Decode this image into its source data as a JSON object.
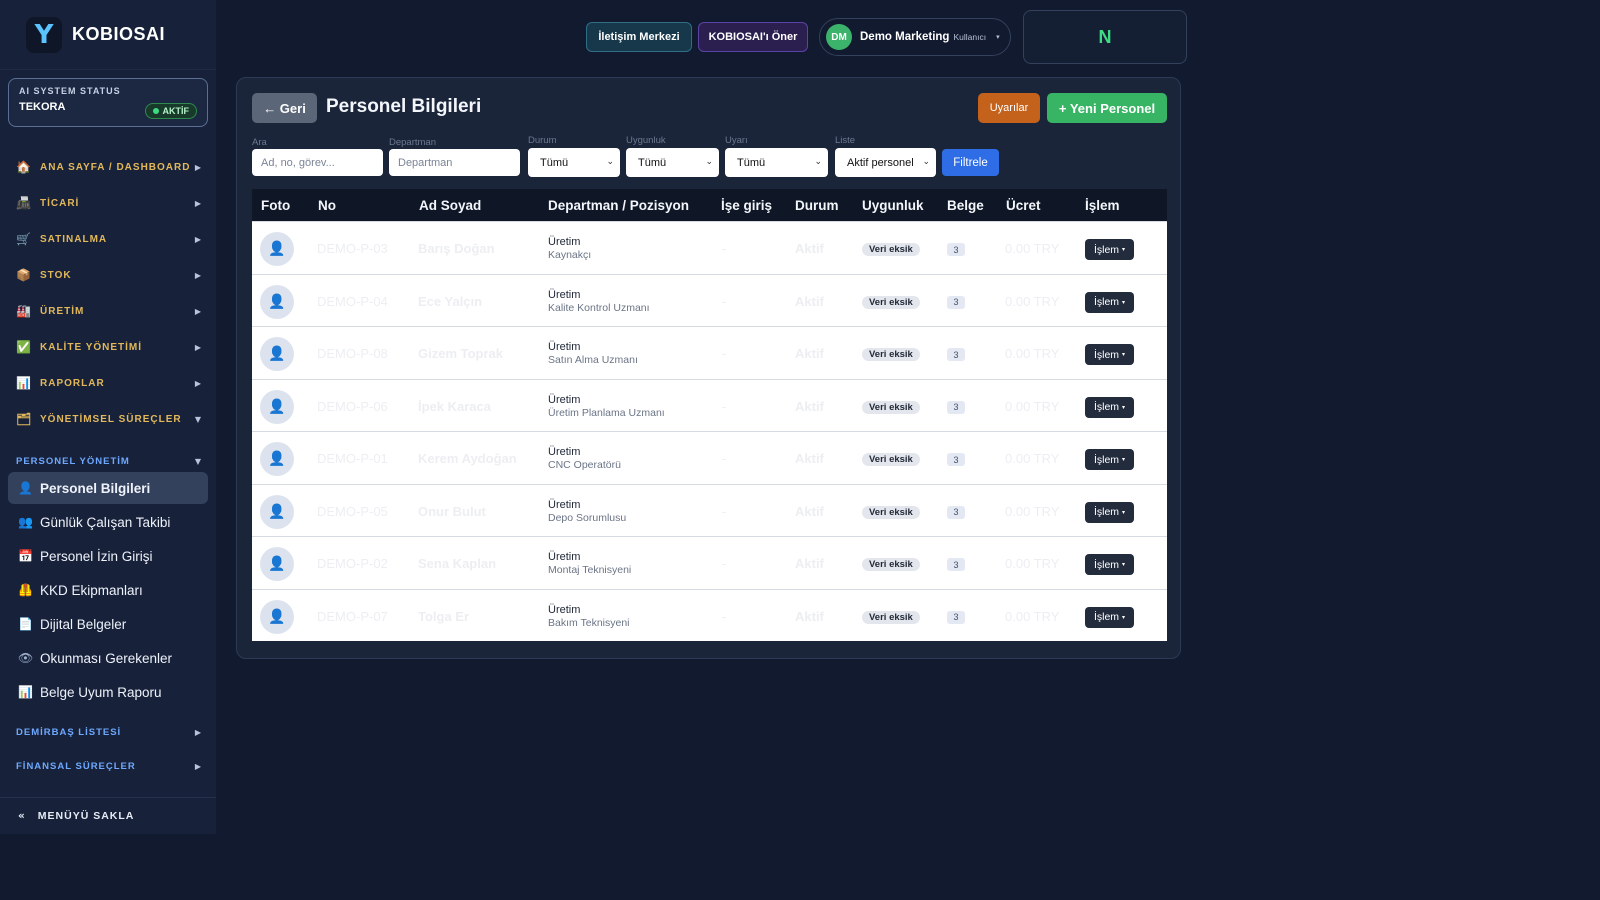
{
  "app": {
    "logo_letter": "Y",
    "name": "KOBIOSAI"
  },
  "system_status": {
    "label": "AI SYSTEM STATUS",
    "name": "TEKORA",
    "badge": "AKTİF"
  },
  "nav": [
    {
      "icon": "home-icon",
      "glyph": "🏠",
      "label": "ANA SAYFA / DASHBOARD",
      "arrow": "▶"
    },
    {
      "icon": "cart-icon",
      "glyph": "📠",
      "label": "TİCARİ",
      "arrow": "▶"
    },
    {
      "icon": "shopping-icon",
      "glyph": "🛒",
      "label": "SATINALMA",
      "arrow": "▶"
    },
    {
      "icon": "box-icon",
      "glyph": "📦",
      "label": "STOK",
      "arrow": "▶"
    },
    {
      "icon": "factory-icon",
      "glyph": "🏭",
      "label": "ÜRETİM",
      "arrow": "▶"
    },
    {
      "icon": "check-icon",
      "glyph": "✅",
      "label": "KALİTE YÖNETİMİ",
      "arrow": "▶"
    },
    {
      "icon": "chart-icon",
      "glyph": "📊",
      "label": "RAPORLAR",
      "arrow": "▶"
    },
    {
      "icon": "folder-icon",
      "glyph": "🗂",
      "label": "YÖNETİMSEL SÜREÇLER",
      "arrow": "▼"
    }
  ],
  "personnel_section": {
    "label": "PERSONEL YÖNETİM",
    "arrow": "▼",
    "items": [
      {
        "icon": "person-icon",
        "glyph": "👤",
        "label": "Personel Bilgileri"
      },
      {
        "icon": "people-icon",
        "glyph": "👥",
        "label": "Günlük Çalışan Takibi"
      },
      {
        "icon": "calendar-icon",
        "glyph": "📅",
        "label": "Personel İzin Girişi"
      },
      {
        "icon": "vest-icon",
        "glyph": "🦺",
        "label": "KKD Ekipmanları"
      },
      {
        "icon": "document-icon",
        "glyph": "📄",
        "label": "Dijital Belgeler"
      },
      {
        "icon": "read-icon",
        "glyph": "👁",
        "label": "Okunması Gerekenler"
      },
      {
        "icon": "report-icon",
        "glyph": "📊",
        "label": "Belge Uyum Raporu"
      }
    ]
  },
  "bottom_sections": [
    {
      "label": "DEMİRBAŞ LİSTESİ",
      "arrow": "▶"
    },
    {
      "label": "FİNANSAL SÜREÇLER",
      "arrow": "▶"
    }
  ],
  "hide_menu": {
    "glyph": "«",
    "label": "MENÜYÜ SAKLA"
  },
  "topbar": {
    "contact_label": "İletişim Merkezi",
    "suggest_label": "KOBIOSAI'ı Öner",
    "user_initials": "DM",
    "user_name": "Demo Marketing",
    "user_role": "Kullanıcı",
    "caret": "▾",
    "n_label": "N"
  },
  "page": {
    "back_label": "← Geri",
    "title": "Personel Bilgileri",
    "warnings_label": "Uyarılar",
    "new_label": "+ Yeni Personel"
  },
  "filters": {
    "search_label": "Ara",
    "search_placeholder": "Ad, no, görev...",
    "dept_label": "Departman",
    "dept_placeholder": "Departman",
    "status_label": "Durum",
    "status_value": "Tümü",
    "suit_label": "Uygunluk",
    "suit_value": "Tümü",
    "warn_label": "Uyarı",
    "warn_value": "Tümü",
    "list_label": "Liste",
    "list_value": "Aktif personel",
    "chevron": "⌄",
    "filter_button": "Filtrele"
  },
  "table": {
    "columns": [
      "Foto",
      "No",
      "Ad Soyad",
      "Departman / Pozisyon",
      "İşe giriş",
      "Durum",
      "Uygunluk",
      "Belge",
      "Ücret",
      "İşlem"
    ],
    "action_label": "İşlem",
    "action_caret": "▾",
    "photo_glyph": "👤",
    "rows": [
      {
        "no": "DEMO-P-03",
        "name": "Barış Doğan",
        "dept": "Üretim",
        "position": "Kaynakçı",
        "start": "-",
        "status": "Aktif",
        "suitability": "Veri eksik",
        "docs": "3",
        "fee": "0.00 TRY"
      },
      {
        "no": "DEMO-P-04",
        "name": "Ece Yalçın",
        "dept": "Üretim",
        "position": "Kalite Kontrol Uzmanı",
        "start": "-",
        "status": "Aktif",
        "suitability": "Veri eksik",
        "docs": "3",
        "fee": "0.00 TRY"
      },
      {
        "no": "DEMO-P-08",
        "name": "Gizem Toprak",
        "dept": "Üretim",
        "position": "Satın Alma Uzmanı",
        "start": "-",
        "status": "Aktif",
        "suitability": "Veri eksik",
        "docs": "3",
        "fee": "0.00 TRY"
      },
      {
        "no": "DEMO-P-06",
        "name": "İpek Karaca",
        "dept": "Üretim",
        "position": "Üretim Planlama Uzmanı",
        "start": "-",
        "status": "Aktif",
        "suitability": "Veri eksik",
        "docs": "3",
        "fee": "0.00 TRY"
      },
      {
        "no": "DEMO-P-01",
        "name": "Kerem Aydoğan",
        "dept": "Üretim",
        "position": "CNC Operatörü",
        "start": "-",
        "status": "Aktif",
        "suitability": "Veri eksik",
        "docs": "3",
        "fee": "0.00 TRY"
      },
      {
        "no": "DEMO-P-05",
        "name": "Onur Bulut",
        "dept": "Üretim",
        "position": "Depo Sorumlusu",
        "start": "-",
        "status": "Aktif",
        "suitability": "Veri eksik",
        "docs": "3",
        "fee": "0.00 TRY"
      },
      {
        "no": "DEMO-P-02",
        "name": "Sena Kaplan",
        "dept": "Üretim",
        "position": "Montaj Teknisyeni",
        "start": "-",
        "status": "Aktif",
        "suitability": "Veri eksik",
        "docs": "3",
        "fee": "0.00 TRY"
      },
      {
        "no": "DEMO-P-07",
        "name": "Tolga Er",
        "dept": "Üretim",
        "position": "Bakım Teknisyeni",
        "start": "-",
        "status": "Aktif",
        "suitability": "Veri eksik",
        "docs": "3",
        "fee": "0.00 TRY"
      }
    ]
  }
}
